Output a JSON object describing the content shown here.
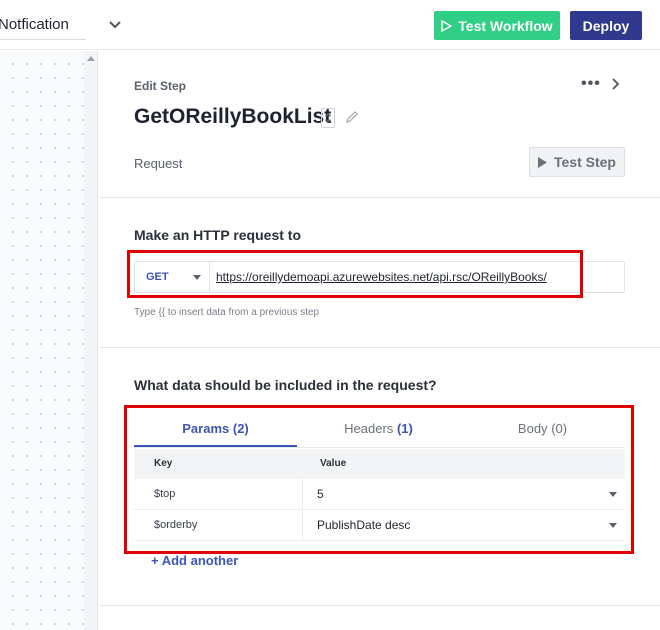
{
  "header": {
    "workflow_title": "Notfication",
    "test_workflow_label": "Test Workflow",
    "deploy_label": "Deploy"
  },
  "step": {
    "edit_label": "Edit Step",
    "more_icon": "•••",
    "name": "GetOReillyBookList",
    "section_label": "Request",
    "test_step_label": "Test Step"
  },
  "request": {
    "heading": "Make an HTTP request to",
    "method": "GET",
    "url": "https://oreillydemoapi.azurewebsites.net/api.rsc/OReillyBooks/",
    "hint": "Type {{ to insert data from a previous step"
  },
  "data": {
    "heading": "What data should be included in the request?",
    "tabs": [
      {
        "label": "Params",
        "count": "(2)"
      },
      {
        "label": "Headers",
        "count": "(1)"
      },
      {
        "label": "Body",
        "count": "(0)"
      }
    ],
    "columns": {
      "key": "Key",
      "value": "Value"
    },
    "rows": [
      {
        "key": "$top",
        "value": "5"
      },
      {
        "key": "$orderby",
        "value": "PublishDate desc"
      }
    ],
    "add_label": "+ Add another"
  },
  "colors": {
    "test_workflow": "#2fcf85",
    "deploy": "#2f3a8f",
    "accent": "#3d54b8",
    "highlight": "#e00000"
  }
}
